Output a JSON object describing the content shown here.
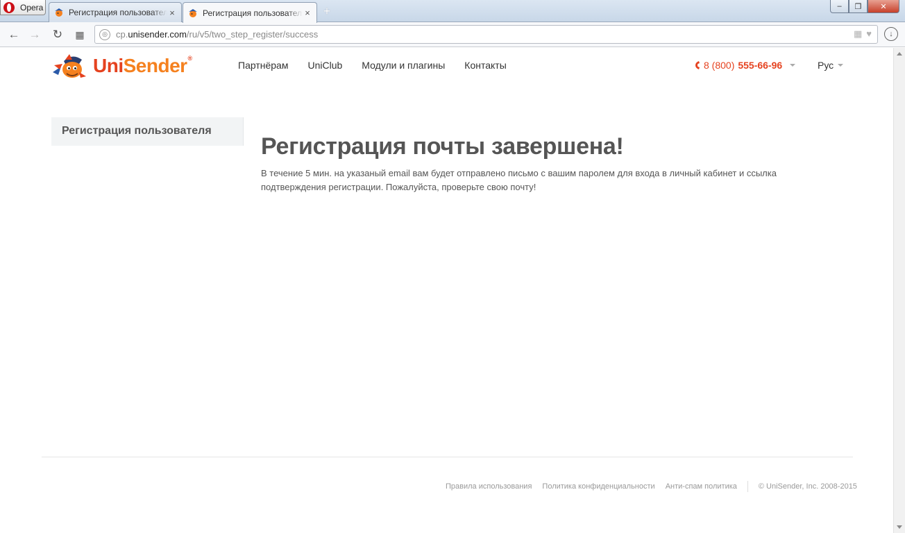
{
  "browser": {
    "app_name": "Opera",
    "tabs": [
      {
        "title": "Регистрация пользователя",
        "active": false
      },
      {
        "title": "Регистрация пользователя",
        "active": true
      }
    ],
    "new_tab_symbol": "+",
    "window_controls": {
      "minimize": "–",
      "maximize": "❐",
      "close": "✕"
    },
    "address": {
      "scheme": "cp.",
      "host": "unisender.com",
      "path": "/ru/v5/two_step_register/success"
    },
    "nav": {
      "back": "←",
      "forward": "→",
      "reload": "↻",
      "speed_dial": "▦"
    },
    "download_symbol": "↓"
  },
  "site": {
    "logo": {
      "prefix": "Uni",
      "suffix": "Sender",
      "reg": "®"
    },
    "nav_items": [
      "Партнёрам",
      "UniClub",
      "Модули и плагины",
      "Контакты"
    ],
    "phone": {
      "prefix": "8 (800)",
      "number": "555-66-96"
    },
    "language": "Рус",
    "sidebar": {
      "items": [
        "Регистрация пользователя"
      ]
    },
    "main": {
      "title": "Регистрация почты завершена!",
      "message": "В течение 5 мин. на указаный email вам будет отправлено письмо с вашим паролем для входа в личный кабинет и ссылка подтверждения регистрации. Пожалуйста, проверьте свою почту!"
    },
    "footer": {
      "links": [
        "Правила использования",
        "Политика конфиденциальности",
        "Анти-спам политика"
      ],
      "copyright": "© UniSender, Inc. 2008-2015"
    }
  },
  "colors": {
    "brand_red": "#e5421f",
    "brand_orange": "#f5811f",
    "text_main": "#555555"
  }
}
